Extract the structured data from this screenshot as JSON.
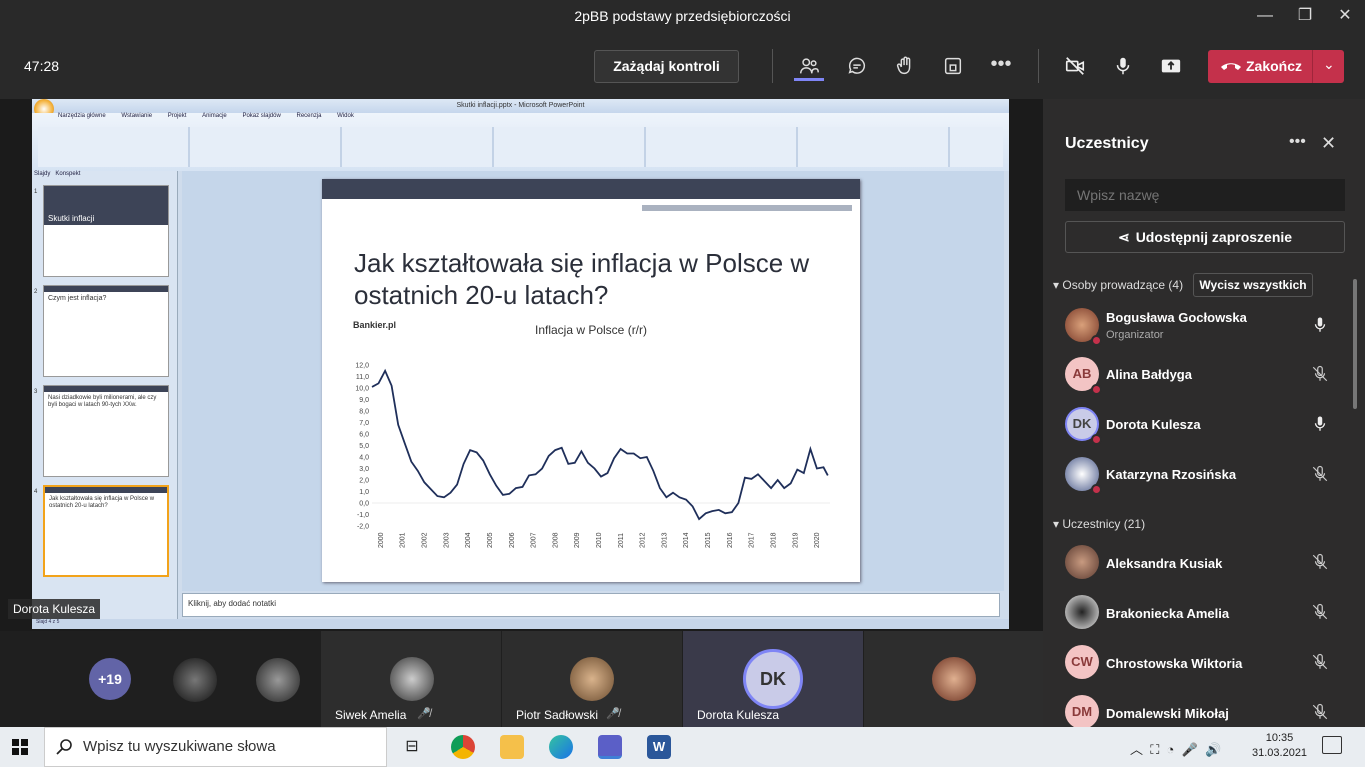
{
  "window": {
    "title": "2pBB podstawy przedsiębiorczości"
  },
  "toolbar": {
    "timer": "47:28",
    "request_control": "Zażądaj kontroli",
    "end_call": "Zakończ"
  },
  "ppt": {
    "title": "Skutki inflacji.pptx - Microsoft PowerPoint",
    "tabs": [
      "Narzędzia główne",
      "Wstawianie",
      "Projekt",
      "Animacje",
      "Pokaz slajdów",
      "Recenzja",
      "Widok"
    ],
    "pane_tabs": [
      "Slajdy",
      "Konspekt"
    ],
    "thumbs": [
      {
        "num": "1",
        "text": "Skutki inflacji"
      },
      {
        "num": "2",
        "text": "Czym jest inflacja?"
      },
      {
        "num": "3",
        "text": "Nasi dziadkowie byli milionerami, ale czy byli bogaci w latach 90-tych XXw."
      },
      {
        "num": "4",
        "text": "Jak kształtowała się inflacja w Polsce w ostatnich 20-u latach?"
      }
    ],
    "notes": "Kliknij, aby dodać notatki",
    "status": "Slajd 4 z 5",
    "slide": {
      "heading": "Jak kształtowała się inflacja w Polsce w ostatnich 20-u latach?",
      "source": "Bankier.pl"
    }
  },
  "chart_data": {
    "type": "line",
    "title": "Inflacja w Polsce (r/r)",
    "xlabel": "",
    "ylabel": "",
    "ylim": [
      -2,
      12
    ],
    "yticks": [
      "12,0",
      "11,0",
      "10,0",
      "9,0",
      "8,0",
      "7,0",
      "6,0",
      "5,0",
      "4,0",
      "3,0",
      "2,0",
      "1,0",
      "0,0",
      "-1,0",
      "-2,0"
    ],
    "xticks": [
      "2000",
      "2001",
      "2002",
      "2003",
      "2004",
      "2005",
      "2006",
      "2007",
      "2008",
      "2009",
      "2010",
      "2011",
      "2012",
      "2013",
      "2014",
      "2015",
      "2016",
      "2017",
      "2018",
      "2019",
      "2020"
    ],
    "x": [
      2000,
      2000.3,
      2000.6,
      2000.9,
      2001.2,
      2001.5,
      2001.8,
      2002.1,
      2002.4,
      2002.7,
      2003.0,
      2003.3,
      2003.6,
      2003.9,
      2004.2,
      2004.5,
      2004.8,
      2005.1,
      2005.4,
      2005.7,
      2006.0,
      2006.3,
      2006.6,
      2006.9,
      2007.2,
      2007.5,
      2007.8,
      2008.1,
      2008.4,
      2008.7,
      2009.0,
      2009.3,
      2009.6,
      2009.9,
      2010.2,
      2010.5,
      2010.8,
      2011.1,
      2011.4,
      2011.7,
      2012.0,
      2012.3,
      2012.6,
      2012.9,
      2013.2,
      2013.5,
      2013.8,
      2014.1,
      2014.4,
      2014.7,
      2015.0,
      2015.3,
      2015.6,
      2015.9,
      2016.2,
      2016.5,
      2016.8,
      2017.1,
      2017.4,
      2017.7,
      2018.0,
      2018.3,
      2018.6,
      2018.9,
      2019.2,
      2019.5,
      2019.8,
      2020.1,
      2020.4,
      2020.7,
      2020.9
    ],
    "values": [
      10.1,
      10.4,
      11.5,
      10.2,
      6.8,
      5.2,
      3.6,
      2.8,
      1.8,
      1.2,
      0.6,
      0.5,
      0.9,
      1.6,
      3.4,
      4.6,
      4.4,
      3.7,
      2.5,
      1.5,
      0.7,
      0.8,
      1.3,
      1.4,
      2.4,
      2.5,
      3.0,
      4.1,
      4.6,
      4.8,
      3.4,
      3.5,
      4.5,
      3.5,
      3.0,
      2.3,
      2.6,
      3.9,
      4.7,
      4.3,
      4.3,
      3.9,
      4.0,
      2.8,
      1.3,
      0.5,
      0.9,
      0.5,
      0.3,
      -0.3,
      -1.4,
      -0.9,
      -0.7,
      -0.6,
      -0.9,
      -0.8,
      0.0,
      2.2,
      2.1,
      2.5,
      1.9,
      1.3,
      2.0,
      1.3,
      1.7,
      2.9,
      2.6,
      4.7,
      3.0,
      3.1,
      2.4
    ]
  },
  "participants_panel": {
    "title": "Uczestnicy",
    "search_placeholder": "Wpisz nazwę",
    "share_invite": "Udostępnij zaproszenie",
    "presenters_header": "Osoby prowadzące (4)",
    "mute_all": "Wycisz wszystkich",
    "attendees_header": "Uczestnicy (21)",
    "presenters": [
      {
        "name": "Bogusława Gocłowska",
        "role": "Organizator",
        "initials": "",
        "mic": "on"
      },
      {
        "name": "Alina Bałdyga",
        "initials": "AB",
        "mic": "off"
      },
      {
        "name": "Dorota Kulesza",
        "initials": "DK",
        "mic": "on"
      },
      {
        "name": "Katarzyna Rzosińska",
        "initials": "",
        "mic": "off"
      }
    ],
    "attendees": [
      {
        "name": "Aleksandra Kusiak",
        "initials": "",
        "mic": "off"
      },
      {
        "name": "Brakoniecka Amelia",
        "initials": "",
        "mic": "off"
      },
      {
        "name": "Chrostowska Wiktoria",
        "initials": "CW",
        "mic": "off"
      },
      {
        "name": "Domalewski Mikołaj",
        "initials": "DM",
        "mic": "off"
      }
    ]
  },
  "stage": {
    "presenter_tag": "Dorota Kulesza"
  },
  "strip": {
    "more": "+19",
    "tiles": [
      {
        "name": "Siwek Amelia"
      },
      {
        "name": "Piotr Sadłowski"
      },
      {
        "name": "Dorota Kulesza",
        "initials": "DK"
      }
    ]
  },
  "taskbar": {
    "search": "Wpisz tu wyszukiwane słowa",
    "time": "10:35",
    "date": "31.03.2021"
  }
}
